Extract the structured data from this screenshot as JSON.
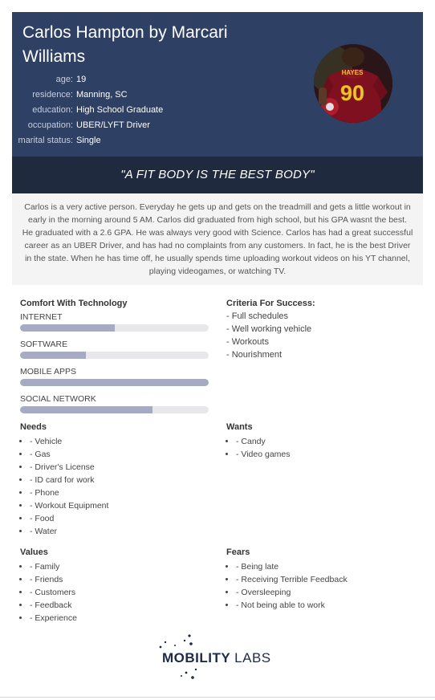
{
  "header": {
    "name": "Carlos Hampton by Marcari Williams",
    "fields": [
      {
        "label": "age:",
        "value": "19"
      },
      {
        "label": "residence:",
        "value": "Manning, SC"
      },
      {
        "label": "education:",
        "value": "High School Graduate"
      },
      {
        "label": "occupation:",
        "value": "UBER/LYFT Driver"
      },
      {
        "label": "marital status:",
        "value": "Single"
      }
    ],
    "photo_text": {
      "name": "HAYES",
      "number": "90"
    }
  },
  "quote": "\"A FIT BODY IS THE BEST BODY\"",
  "bio": "Carlos is a very active person. Everyday he gets up and gets on the treadmill and gets a little workout in early in the morning around 5 AM. Carlos did graduated from high school, but his GPA wasnt the best. He graduated with a 2.6 GPA. He was always very good with Science. Carlos has had a great successful career as an UBER Driver, and has had no complaints from any customers. In fact, he is the best Driver in the state. When he has time off, he usually spends time uploading workout videos on his YT channel, playing videogames, or watching TV.",
  "technology": {
    "title": "Comfort With Technology",
    "items": [
      {
        "label": "INTERNET",
        "level": 0.5
      },
      {
        "label": "SOFTWARE",
        "level": 0.35
      },
      {
        "label": "MOBILE APPS",
        "level": 1.0
      },
      {
        "label": "SOCIAL NETWORK",
        "level": 0.7
      }
    ]
  },
  "criteria": {
    "title": "Criteria For Success:",
    "items": [
      "- Full schedules",
      "- Well working vehicle",
      "- Workouts",
      "- Nourishment"
    ]
  },
  "needs": {
    "title": "Needs",
    "items": [
      "- Vehicle",
      "- Gas",
      "- Driver's License",
      "- ID card for work",
      "- Phone",
      "- Workout Equipment",
      "- Food",
      "- Water"
    ]
  },
  "wants": {
    "title": "Wants",
    "items": [
      "- Candy",
      "- Video games"
    ]
  },
  "values": {
    "title": "Values",
    "items": [
      "- Family",
      "- Friends",
      "- Customers",
      "- Feedback",
      "- Experience"
    ]
  },
  "fears": {
    "title": "Fears",
    "items": [
      "- Being late",
      "- Receiving Terrible Feedback",
      "- Oversleeping",
      "- Not being able to work"
    ]
  },
  "logo": {
    "bold": "MOBILITY",
    "light": "LABS"
  },
  "colors": {
    "header": "#2e4063",
    "quote_band": "#1f2a3f",
    "bar_fill": "#a6aac3",
    "bar_track": "#e8e8ea"
  }
}
